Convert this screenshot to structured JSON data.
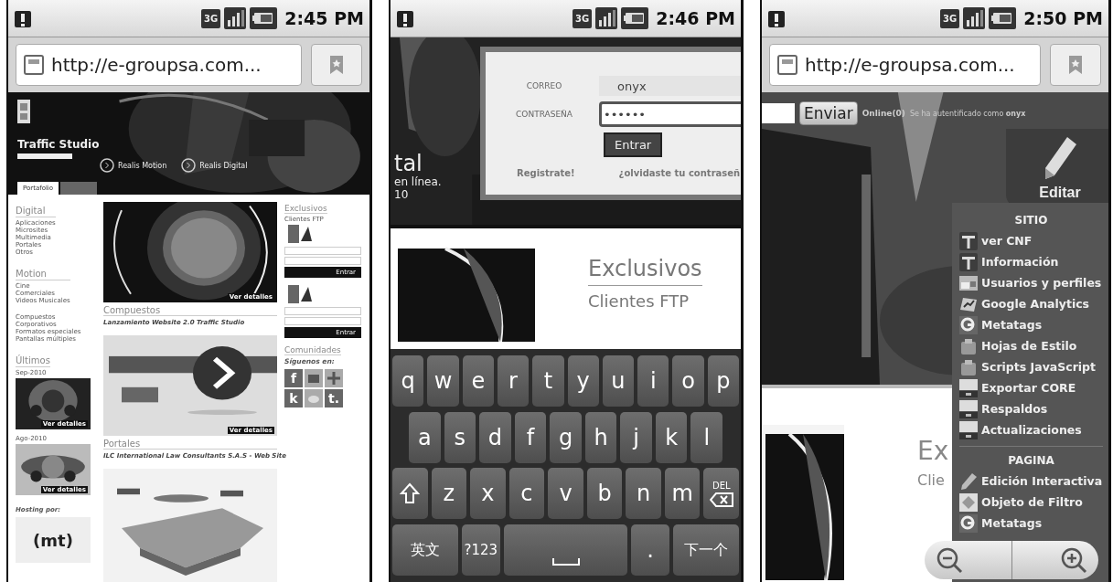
{
  "screens": [
    {
      "kind": "site",
      "status_bar": {
        "time": "2:45 PM",
        "network": "3G"
      },
      "address_bar": {
        "url": "http://e-groupsa.com..."
      },
      "hero": {
        "title": "Traffic Studio",
        "features": [
          {
            "title": "Realis Motion"
          },
          {
            "title": "Realis Digital"
          }
        ]
      },
      "tabs": [
        {
          "label": "Portafolio",
          "selected": true
        },
        {
          "selected": false
        }
      ],
      "left": [
        {
          "heading": "Digital",
          "items": [
            "Aplicaciones",
            "Microsites",
            "Multimedia",
            "Portales",
            "Otros"
          ]
        },
        {
          "heading": "Motion",
          "items": [
            "Cine",
            "Comerciales",
            "Videos Musicales"
          ]
        },
        {
          "items": [
            "Compuestos",
            "Corporativos",
            "Formatos especiales",
            "Pantallas múltiples"
          ]
        }
      ],
      "latest": {
        "heading": "Últimos",
        "entries": [
          {
            "date": "Sep-2010",
            "overlay": "Ver detalles"
          },
          {
            "date": "Ago-2010",
            "overlay": "Ver detalles"
          }
        ]
      },
      "hosting": {
        "label": "Hosting por:",
        "logo": "(mt)"
      },
      "projects": [
        {
          "overlay": "Ver detalles",
          "heading": "Compuestos",
          "title": "Lanzamiento Website 2.0 Traffic Studio"
        },
        {
          "overlay": "Ver detalles",
          "heading": "Portales",
          "title": "ILC International Law Consultants S.A.S - Web Site"
        }
      ],
      "right": {
        "heading": "Exclusivos",
        "sub": "Clientes FTP",
        "buttons": [
          "Entrar",
          "Entrar"
        ],
        "communities": "Comunidades",
        "follow": "Síguenos en:",
        "social": [
          {
            "glyph": "f"
          },
          {
            "kind": "tv"
          },
          {
            "kind": "grid"
          },
          {
            "glyph": "k"
          },
          {
            "kind": "bird"
          },
          {
            "glyph": "t."
          }
        ]
      }
    },
    {
      "kind": "login",
      "status_bar": {
        "time": "2:46 PM",
        "network": "3G"
      },
      "behind": [
        "tal",
        "en línea.",
        "10"
      ],
      "login": {
        "fields": [
          {
            "label": "CORREO",
            "value": "onyx",
            "focused": false
          },
          {
            "label": "CONTRASEÑA",
            "value": "••••••",
            "focused": true
          }
        ],
        "button": "Entrar",
        "links": [
          "Registrate!",
          "¿olvidaste tu contraseñ"
        ]
      },
      "web": {
        "heading": "Exclusivos",
        "sub": "Clientes FTP"
      },
      "keyboard": [
        [
          {
            "label": "q"
          },
          {
            "label": "w"
          },
          {
            "label": "e"
          },
          {
            "label": "r"
          },
          {
            "label": "t"
          },
          {
            "label": "y"
          },
          {
            "label": "u"
          },
          {
            "label": "i"
          },
          {
            "label": "o"
          },
          {
            "label": "p"
          }
        ],
        [
          {
            "label": "a"
          },
          {
            "label": "s"
          },
          {
            "label": "d"
          },
          {
            "label": "f"
          },
          {
            "label": "g"
          },
          {
            "label": "h"
          },
          {
            "label": "j"
          },
          {
            "label": "k"
          },
          {
            "label": "l"
          }
        ],
        [
          {
            "kind": "shift"
          },
          {
            "label": "z"
          },
          {
            "label": "x"
          },
          {
            "label": "c"
          },
          {
            "label": "v"
          },
          {
            "label": "b"
          },
          {
            "label": "n"
          },
          {
            "label": "m"
          },
          {
            "kind": "del",
            "label": "DEL"
          }
        ],
        [
          {
            "kind": "wide",
            "label": "英文"
          },
          {
            "label": "?123"
          },
          {
            "kind": "space"
          },
          {
            "label": "."
          },
          {
            "kind": "wide",
            "label": "下一个"
          }
        ]
      ]
    },
    {
      "kind": "admin",
      "status_bar": {
        "time": "2:50 PM",
        "network": "3G"
      },
      "address_bar": {
        "url": "http://e-groupsa.com..."
      },
      "topbar": {
        "button": "Enviar",
        "online": "Online(0)",
        "message": "Se ha autentificado como",
        "user": "onyx"
      },
      "edit": "Editar",
      "peek": [
        "Ex",
        "Clie"
      ],
      "menu": [
        {
          "heading": "SITIO",
          "items": [
            {
              "label": "ver CNF",
              "kind": "t"
            },
            {
              "label": "Información",
              "kind": "t"
            },
            {
              "label": "Usuarios y perfiles",
              "kind": "users"
            },
            {
              "label": "Google Analytics",
              "kind": "analytics"
            },
            {
              "label": "Metatags",
              "kind": "g"
            },
            {
              "label": "Hojas de Estilo",
              "kind": "box"
            },
            {
              "label": "Scripts JavaScript",
              "kind": "box"
            },
            {
              "label": "Exportar CORE",
              "kind": "screen"
            },
            {
              "label": "Respaldos",
              "kind": "screen"
            },
            {
              "label": "Actualizaciones",
              "kind": "screen"
            }
          ]
        },
        {
          "heading": "PAGINA",
          "items": [
            {
              "label": "Edición Interactiva",
              "kind": "pencil"
            },
            {
              "label": "Objeto de Filtro",
              "kind": "filter"
            },
            {
              "label": "Metatags",
              "kind": "g"
            }
          ]
        }
      ]
    }
  ]
}
